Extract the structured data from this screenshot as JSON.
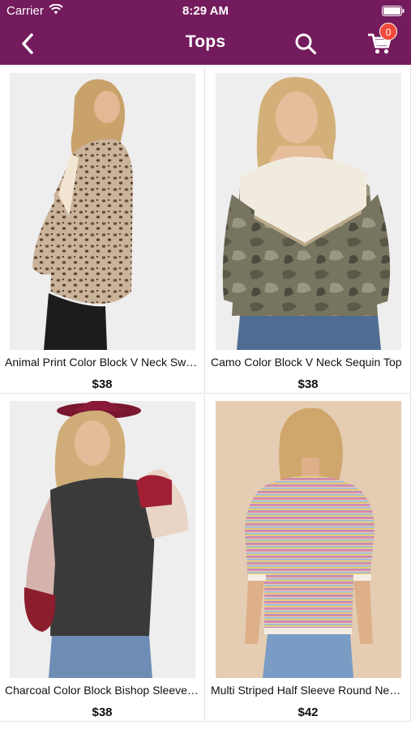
{
  "status": {
    "carrier": "Carrier",
    "time": "8:29 AM"
  },
  "header": {
    "title": "Tops",
    "cart_count": "0",
    "icons": {
      "back": "chevron-left-icon",
      "search": "search-icon",
      "cart": "cart-icon"
    }
  },
  "colors": {
    "header_bg": "#731b5c",
    "badge": "#f04a3a"
  },
  "products": [
    {
      "title": "Animal Print Color Block V Neck Sweater",
      "price": "$38"
    },
    {
      "title": "Camo Color Block V Neck Sequin Top",
      "price": "$38"
    },
    {
      "title": "Charcoal Color Block Bishop Sleeve Top",
      "price": "$38"
    },
    {
      "title": "Multi Striped Half Sleeve Round Neck Top",
      "price": "$42"
    }
  ]
}
